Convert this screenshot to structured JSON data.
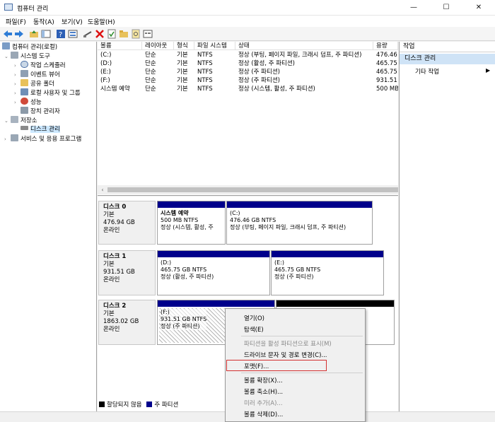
{
  "window": {
    "title": "컴퓨터 관리",
    "controls": [
      "—",
      "☐",
      "✕"
    ]
  },
  "menu": [
    "파일(F)",
    "동작(A)",
    "보기(V)",
    "도움말(H)"
  ],
  "tree": {
    "root": "컴퓨터 관리(로컬)",
    "system_tools": "시스템 도구",
    "task_scheduler": "작업 스케줄러",
    "event_viewer": "이벤트 뷰어",
    "shared_folders": "공유 폴더",
    "local_users": "로컬 사용자 및 그룹",
    "performance": "성능",
    "device_manager": "장치 관리자",
    "storage": "저장소",
    "disk_management": "디스크 관리",
    "services": "서비스 및 응용 프로그램"
  },
  "volume_list": {
    "headers": [
      "볼륨",
      "레이아웃",
      "형식",
      "파일 시스템",
      "상태",
      "용량"
    ],
    "rows": [
      [
        "(C:)",
        "단순",
        "기본",
        "NTFS",
        "정상 (부팅, 페이지 파일, 크래시 덤프, 주 파티션)",
        "476.46"
      ],
      [
        "(D:)",
        "단순",
        "기본",
        "NTFS",
        "정상 (활성, 주 파티션)",
        "465.75"
      ],
      [
        "(E:)",
        "단순",
        "기본",
        "NTFS",
        "정상 (주 파티션)",
        "465.75"
      ],
      [
        "(F:)",
        "단순",
        "기본",
        "NTFS",
        "정상 (주 파티션)",
        "931.51"
      ],
      [
        "시스템 예약",
        "단순",
        "기본",
        "NTFS",
        "정상 (시스템, 활성, 주 파티션)",
        "500 MB"
      ]
    ]
  },
  "disks": [
    {
      "name": "디스크 0",
      "type": "기본",
      "size": "476.94 GB",
      "state": "온라인",
      "partitions": [
        {
          "name": "시스템 예약",
          "detail": "500 MB NTFS",
          "status": "정상 (시스템, 활성, 주"
        },
        {
          "name": "(C:)",
          "detail": "476.46 GB NTFS",
          "status": "정상 (부팅, 페이지 파일, 크래시 덤프, 주 파티션)"
        }
      ]
    },
    {
      "name": "디스크 1",
      "type": "기본",
      "size": "931.51 GB",
      "state": "온라인",
      "partitions": [
        {
          "name": "(D:)",
          "detail": "465.75 GB NTFS",
          "status": "정상 (활성, 주 파티션)"
        },
        {
          "name": "(E:)",
          "detail": "465.75 GB NTFS",
          "status": "정상 (주 파티션)"
        }
      ]
    },
    {
      "name": "디스크 2",
      "type": "기본",
      "size": "1863.02 GB",
      "state": "온라인",
      "partitions": [
        {
          "name": "(F:)",
          "detail": "931.51 GB NTFS",
          "status": "정상 (주 파티션)"
        }
      ]
    }
  ],
  "legend": {
    "unallocated": "할당되지 않음",
    "primary": "주 파티션"
  },
  "actions": {
    "title": "작업",
    "section": "디스크 관리",
    "more": "기타 작업"
  },
  "context_menu": {
    "open": "열기(O)",
    "explore": "탐색(E)",
    "mark_active": "파티션을 활성 파티션으로 표시(M)",
    "change_letter": "드라이브 문자 및 경로 변경(C)...",
    "format": "포맷(F)...",
    "extend": "볼륨 확장(X)...",
    "shrink": "볼륨 축소(H)...",
    "add_mirror": "미러 추가(A)...",
    "delete": "볼륨 삭제(D)..."
  },
  "colors": {
    "primary_partition": "#00008b",
    "unallocated": "#000000",
    "highlight": "#d32f2f",
    "action_section": "#cfe3f6"
  }
}
